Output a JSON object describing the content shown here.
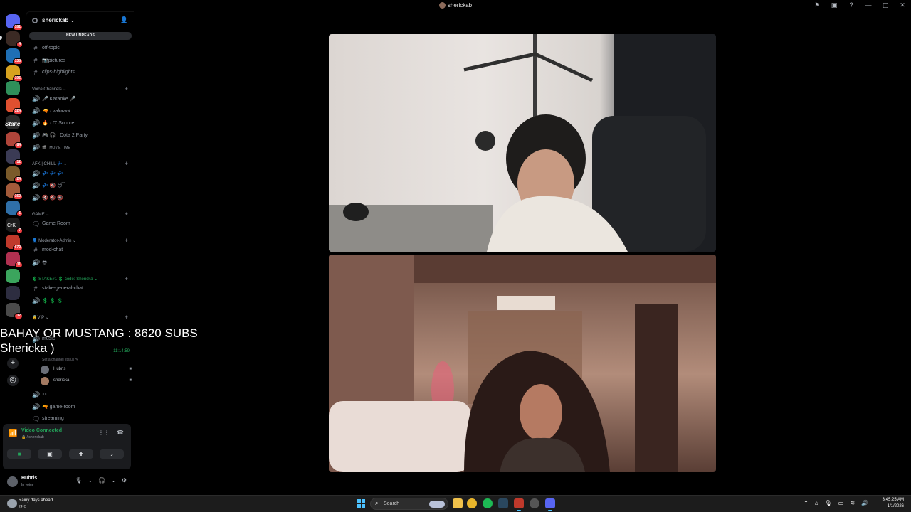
{
  "window": {
    "title": "sherickab",
    "controls": [
      "⚑",
      "▣",
      "?",
      "—",
      "▢",
      "✕"
    ]
  },
  "servers": [
    {
      "badge": "181",
      "color": "#5865f2"
    },
    {
      "badge": "4",
      "color": "#3b2a24"
    },
    {
      "badge": "138",
      "color": "#1f6fb5"
    },
    {
      "badge": "195",
      "color": "#d7a21f"
    },
    {
      "badge": "",
      "color": "#2f8f5a"
    },
    {
      "badge": "324",
      "color": "#e05030"
    },
    {
      "badge": "",
      "color": "#2a2a2a"
    },
    {
      "badge": "84",
      "color": "#b0453a"
    },
    {
      "badge": "12",
      "color": "#3b3b55"
    },
    {
      "badge": "24",
      "color": "#7a5a2a"
    },
    {
      "badge": "162",
      "color": "#a35a3a"
    },
    {
      "badge": "5",
      "color": "#2f6fa8"
    },
    {
      "badge": "7",
      "color": "#1c1c1c"
    },
    {
      "badge": "672",
      "color": "#c0392b"
    },
    {
      "badge": "11",
      "color": "#b03050"
    },
    {
      "badge": "",
      "color": "#3ba55d"
    },
    {
      "badge": "",
      "color": "#2d2d40"
    },
    {
      "badge": "32",
      "color": "#4a4a4a"
    }
  ],
  "rail_labels": {
    "stake": "Stake",
    "crk": "CrK"
  },
  "guild": {
    "name": "sherickab ⌄",
    "new_unreads": "NEW UNREADS"
  },
  "channels": {
    "off_topic": "off-topic",
    "pictures": "📷pictures",
    "clips": "clips-highlights",
    "cat_voice": "Voice Channels ⌄",
    "karaoke": "🎤 Karaoke 🎤",
    "valorant": "🔫 · valorant",
    "d_source": "🔥 · D' Source",
    "dota": "🎮 🎧 | Dota 2 Party",
    "movie": "🎬 ⁞ MOVIE TIME",
    "cat_afk": "AFK | CHILL 💤 ⌄",
    "afk1": "💤 💤 💤",
    "afk2": "💤 🔇 😴",
    "afk3": "🔇 🔇 🔇",
    "cat_game": "GAME ⌄",
    "game_room": "Game Room",
    "cat_mod": "👤 Moderator-Admin ⌄",
    "mod_chat": "mod-chat",
    "mod_voice": "😎",
    "cat_stake": "💲 STAKE#1 💲 code: Shericka ⌄",
    "stake_chat": "stake-general-chat",
    "stake_voice": "💲 💲 💲",
    "cat_vip": "🔒VIP ⌄",
    "music": "music",
    "timer": "11:14:59",
    "channel_status": "Set a channel status ✎",
    "xx": "xx",
    "game_room2": "🔫 game-room",
    "streaming": "streaming"
  },
  "voice_users": [
    {
      "name": "Hubris",
      "color": "#6b6f78"
    },
    {
      "name": "shericka",
      "color": "#a37a62"
    }
  ],
  "voice_panel": {
    "status": "Video Connected",
    "sub": "🔒 / sherickab"
  },
  "user": {
    "name": "Hubris",
    "status": "In voice"
  },
  "overlay": {
    "line1": "BAHAY OR MUSTANG : 8620 SUBS",
    "line2": "Shericka )"
  },
  "taskbar": {
    "weather_title": "Rainy days ahead",
    "weather_temp": "24°C",
    "search_placeholder": "Search",
    "time": "3:45:25 AM",
    "date": "1/1/2026",
    "apps": [
      {
        "name": "file-explorer-app-icon",
        "color": "#f0c14b"
      },
      {
        "name": "chrome-app-icon",
        "color": "#e8b52b"
      },
      {
        "name": "spotify-app-icon",
        "color": "#1db954"
      },
      {
        "name": "steam-app-icon",
        "color": "#2a475e"
      },
      {
        "name": "app-icon-red",
        "color": "#c0392b"
      },
      {
        "name": "app-icon-gray",
        "color": "#555"
      },
      {
        "name": "discord-app-icon",
        "color": "#5865f2"
      }
    ]
  }
}
